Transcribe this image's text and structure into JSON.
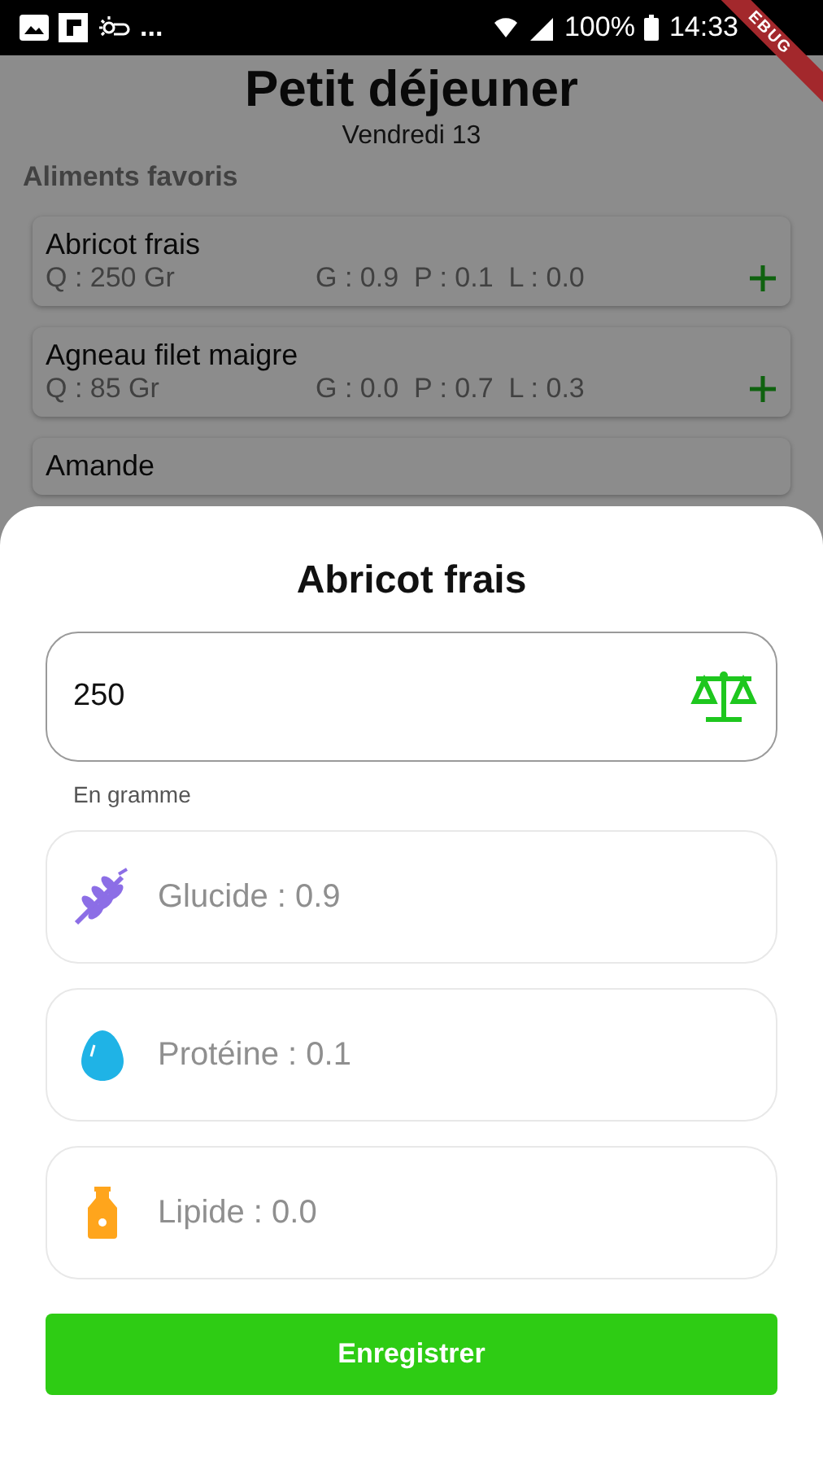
{
  "status_bar": {
    "overflow": "...",
    "battery": "100%",
    "time": "14:33"
  },
  "debug_banner": "EBUG",
  "page": {
    "title": "Petit déjeuner",
    "subtitle": "Vendredi 13",
    "section": "Aliments favoris",
    "foods": [
      {
        "name": "Abricot frais",
        "quantity": "Q : 250 Gr",
        "macros": "G : 0.9  P : 0.1  L : 0.0"
      },
      {
        "name": "Agneau filet maigre",
        "quantity": "Q : 85 Gr",
        "macros": "G : 0.0  P : 0.7  L : 0.3"
      },
      {
        "name": "Amande"
      }
    ]
  },
  "sheet": {
    "title": "Abricot frais",
    "quantity_field": {
      "value": "250",
      "helper": "En gramme"
    },
    "nutrients": [
      {
        "kind": "glucide",
        "label": "Glucide : 0.9"
      },
      {
        "kind": "proteine",
        "label": "Protéine : 0.1"
      },
      {
        "kind": "lipide",
        "label": "Lipide : 0.0"
      }
    ],
    "button": "Enregistrer"
  }
}
